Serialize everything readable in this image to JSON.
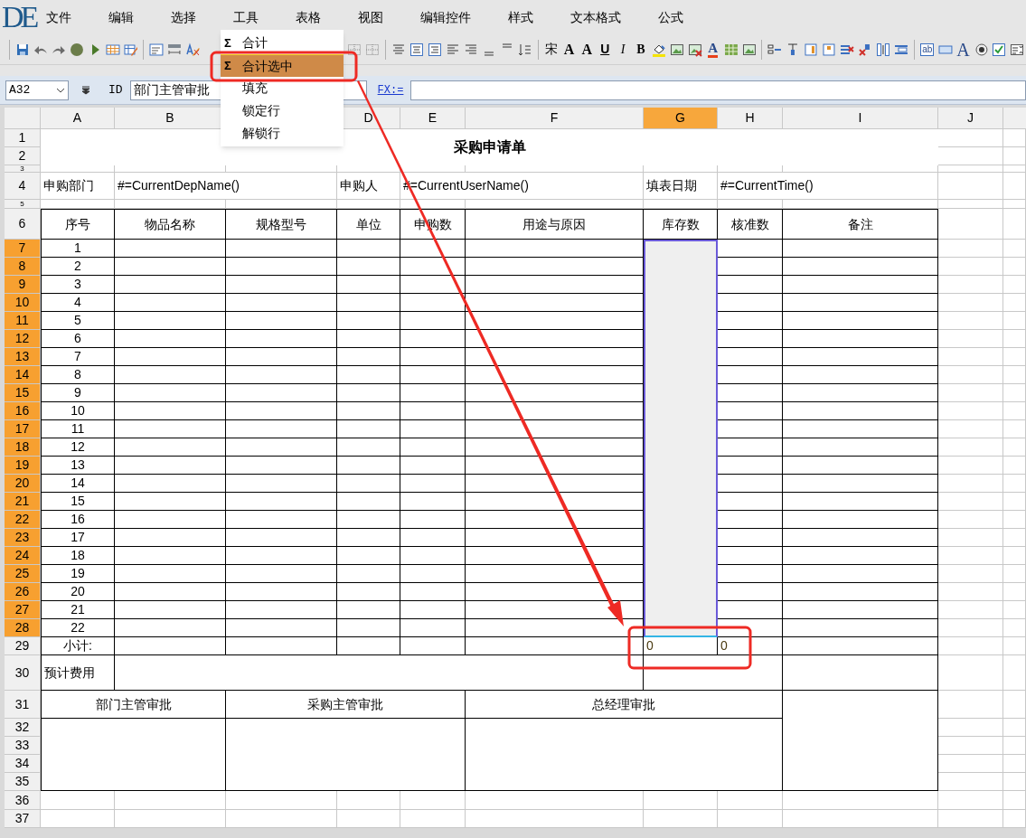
{
  "app": {
    "logo": "DE",
    "menu": [
      "文件",
      "编辑",
      "选择",
      "工具",
      "表格",
      "视图",
      "编辑控件",
      "样式",
      "文本格式",
      "公式"
    ]
  },
  "dropdown": {
    "items": [
      {
        "label": "合计",
        "icon": "Σ",
        "selected": false
      },
      {
        "label": "合计选中",
        "icon": "Σ",
        "selected": true
      },
      {
        "label": "填充",
        "selected": false
      },
      {
        "label": "锁定行",
        "selected": false
      },
      {
        "label": "解锁行",
        "selected": false
      }
    ]
  },
  "toolbar_glyphs": [
    {
      "kind": "font",
      "text": "宋"
    },
    {
      "kind": "shrink",
      "text": "A"
    },
    {
      "kind": "grow",
      "text": "A"
    },
    {
      "kind": "underline",
      "text": "U"
    },
    {
      "kind": "italic",
      "text": "I"
    },
    {
      "kind": "bold",
      "text": "B"
    },
    {
      "kind": "color",
      "text": "A"
    },
    {
      "kind": "textbox",
      "text": "ab"
    },
    {
      "kind": "label",
      "text": "A"
    }
  ],
  "formula_bar": {
    "cell_ref": "A32",
    "id_label": "ID",
    "id_value": "部门主管审批",
    "fx_link": "FX:="
  },
  "sheet": {
    "columns_left": [
      {
        "label": "A",
        "selected": false
      },
      {
        "label": "B",
        "selected": false
      }
    ],
    "columns_right": [
      {
        "label": "D",
        "selected": false
      },
      {
        "label": "E",
        "selected": false
      },
      {
        "label": "F",
        "selected": false
      },
      {
        "label": "G",
        "selected": true
      },
      {
        "label": "H",
        "selected": false
      },
      {
        "label": "I",
        "selected": false
      },
      {
        "label": "J",
        "selected": false
      }
    ],
    "rows": [
      {
        "label": "1",
        "selected": false
      },
      {
        "label": "2",
        "selected": false
      },
      {
        "label": "3",
        "selected": false
      },
      {
        "label": "4",
        "selected": false
      },
      {
        "label": "5",
        "selected": false
      },
      {
        "label": "6",
        "selected": false
      },
      {
        "label": "7",
        "selected": true
      },
      {
        "label": "8",
        "selected": true
      },
      {
        "label": "9",
        "selected": true
      },
      {
        "label": "10",
        "selected": true
      },
      {
        "label": "11",
        "selected": true
      },
      {
        "label": "12",
        "selected": true
      },
      {
        "label": "13",
        "selected": true
      },
      {
        "label": "14",
        "selected": true
      },
      {
        "label": "15",
        "selected": true
      },
      {
        "label": "16",
        "selected": true
      },
      {
        "label": "17",
        "selected": true
      },
      {
        "label": "18",
        "selected": true
      },
      {
        "label": "19",
        "selected": true
      },
      {
        "label": "20",
        "selected": true
      },
      {
        "label": "21",
        "selected": true
      },
      {
        "label": "22",
        "selected": true
      },
      {
        "label": "23",
        "selected": true
      },
      {
        "label": "24",
        "selected": true
      },
      {
        "label": "25",
        "selected": true
      },
      {
        "label": "26",
        "selected": true
      },
      {
        "label": "27",
        "selected": true
      },
      {
        "label": "28",
        "selected": true
      },
      {
        "label": "29",
        "selected": false
      },
      {
        "label": "30",
        "selected": false
      },
      {
        "label": "31",
        "selected": false
      },
      {
        "label": "32",
        "selected": false
      },
      {
        "label": "33",
        "selected": false
      },
      {
        "label": "34",
        "selected": false
      },
      {
        "label": "35",
        "selected": false
      },
      {
        "label": "36",
        "selected": false
      },
      {
        "label": "37",
        "selected": false
      }
    ]
  },
  "form": {
    "title": "采购申请单",
    "info": [
      "申购部门",
      "#=CurrentDepName()",
      "申购人",
      "#=CurrentUserName()",
      "填表日期",
      "#=CurrentTime()"
    ],
    "headers": [
      "序号",
      "物品名称",
      "规格型号",
      "单位",
      "申购数",
      "用途与原因",
      "库存数",
      "核准数",
      "备注"
    ],
    "item_numbers": [
      "1",
      "2",
      "3",
      "4",
      "5",
      "6",
      "7",
      "8",
      "9",
      "10",
      "11",
      "12",
      "13",
      "14",
      "15",
      "16",
      "17",
      "18",
      "19",
      "20",
      "21",
      "22"
    ],
    "subtotal": {
      "label": "小计:",
      "values": [
        "0",
        "0"
      ]
    },
    "estimate_label": "预计费用",
    "approvals": [
      "部门主管审批",
      "采购主管审批",
      "总经理审批"
    ]
  }
}
